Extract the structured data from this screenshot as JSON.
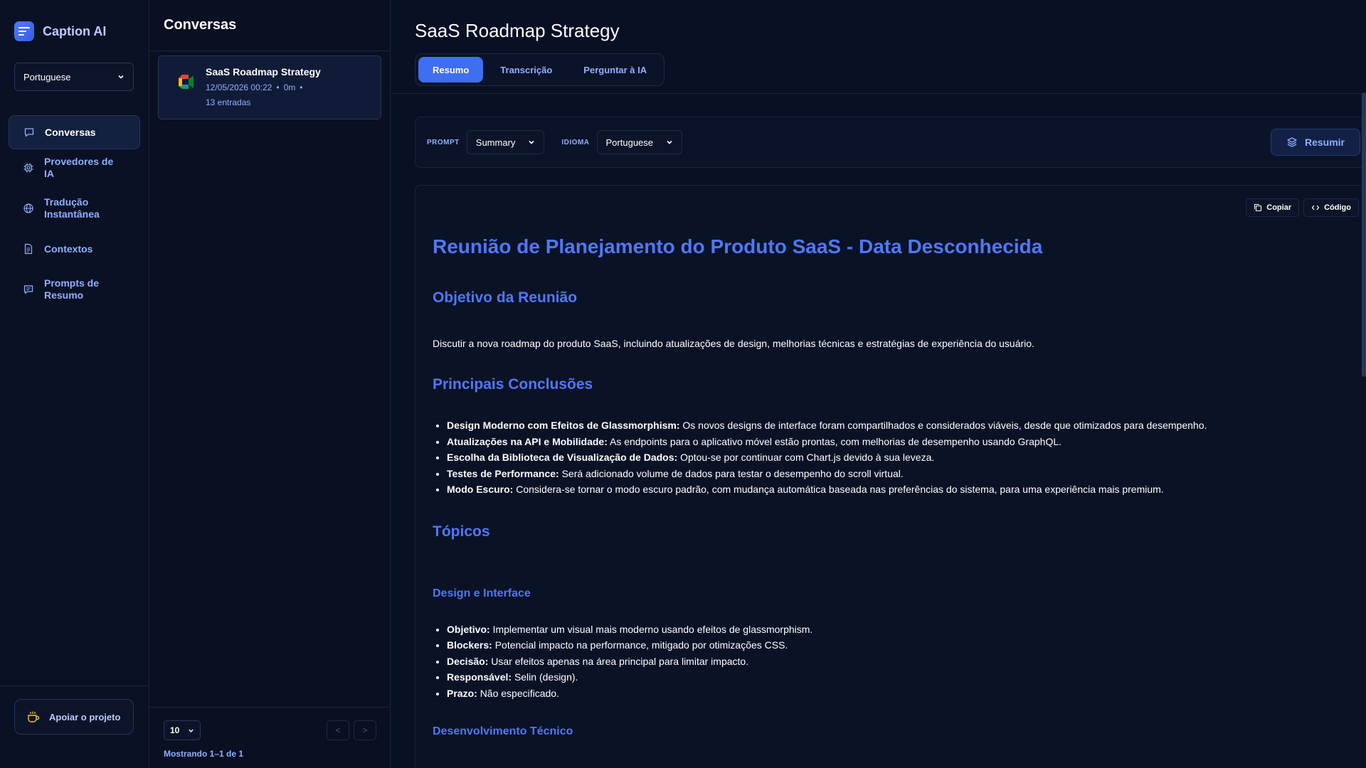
{
  "app": {
    "title": "Caption AI"
  },
  "sidebar": {
    "language": "Portuguese",
    "items": [
      {
        "label": "Conversas",
        "icon": "chat-icon"
      },
      {
        "label": "Provedores de IA",
        "icon": "chip-icon"
      },
      {
        "label": "Tradução Instantânea",
        "icon": "globe-icon"
      },
      {
        "label": "Contextos",
        "icon": "document-icon"
      },
      {
        "label": "Prompts de Resumo",
        "icon": "message-icon"
      }
    ],
    "support_label": "Apoiar o projeto"
  },
  "conversations": {
    "title": "Conversas",
    "items": [
      {
        "title": "SaaS Roadmap Strategy",
        "date": "12/05/2026 00:22",
        "duration": "0m",
        "entries": "13 entradas"
      }
    ],
    "page_size": "10",
    "prev": "<",
    "next": ">",
    "showing": "Mostrando 1–1 de 1"
  },
  "main": {
    "title": "SaaS Roadmap Strategy",
    "tabs": [
      "Resumo",
      "Transcrição",
      "Perguntar à IA"
    ],
    "toolbar": {
      "prompt_label": "PROMPT",
      "prompt_value": "Summary",
      "language_label": "IDIOMA",
      "language_value": "Portuguese",
      "summarize_label": "Resumir"
    },
    "actions": {
      "copy": "Copiar",
      "code": "Código"
    }
  },
  "document": {
    "h1": "Reunião de Planejamento do Produto SaaS - Data Desconhecida",
    "objective_heading": "Objetivo da Reunião",
    "objective_text": "Discutir a nova roadmap do produto SaaS, incluindo atualizações de design, melhorias técnicas e estratégias de experiência do usuário.",
    "conclusions_heading": "Principais Conclusões",
    "conclusions": [
      {
        "term": "Design Moderno com Efeitos de Glassmorphism:",
        "text": "Os novos designs de interface foram compartilhados e considerados viáveis, desde que otimizados para desempenho."
      },
      {
        "term": "Atualizações na API e Mobilidade:",
        "text": "As endpoints para o aplicativo móvel estão prontas, com melhorias de desempenho usando GraphQL."
      },
      {
        "term": "Escolha da Biblioteca de Visualização de Dados:",
        "text": "Optou-se por continuar com Chart.js devido à sua leveza."
      },
      {
        "term": "Testes de Performance:",
        "text": "Será adicionado volume de dados para testar o desempenho do scroll virtual."
      },
      {
        "term": "Modo Escuro:",
        "text": "Considera-se tornar o modo escuro padrão, com mudança automática baseada nas preferências do sistema, para uma experiência mais premium."
      }
    ],
    "topics_heading": "Tópicos",
    "design_heading": "Design e Interface",
    "design_items": [
      {
        "term": "Objetivo:",
        "text": "Implementar um visual mais moderno usando efeitos de glassmorphism."
      },
      {
        "term": "Blockers:",
        "text": "Potencial impacto na performance, mitigado por otimizações CSS."
      },
      {
        "term": "Decisão:",
        "text": "Usar efeitos apenas na área principal para limitar impacto."
      },
      {
        "term": "Responsável:",
        "text": "Selin (design)."
      },
      {
        "term": "Prazo:",
        "text": "Não especificado."
      }
    ],
    "tech_heading": "Desenvolvimento Técnico"
  },
  "colors": {
    "accent": "#3f6ef0",
    "heading": "#4f78f5",
    "link_text": "#8fb0ff",
    "background": "#070d1f"
  }
}
